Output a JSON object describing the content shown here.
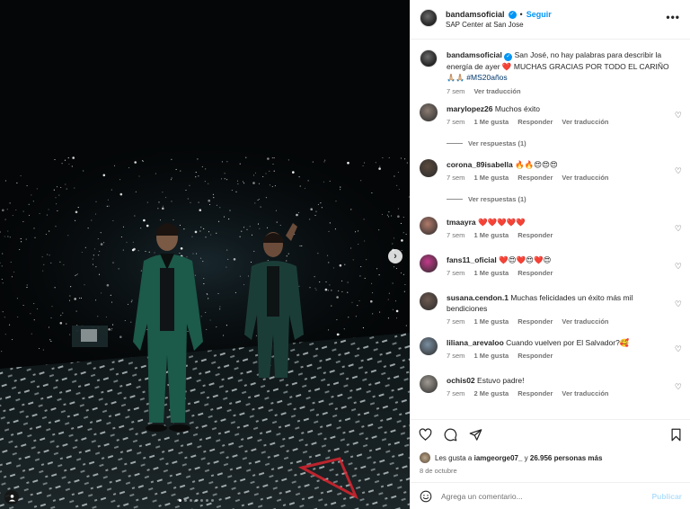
{
  "post": {
    "username": "bandamsoficial",
    "separator": "•",
    "follow_label": "Seguir",
    "location": "SAP Center at San Jose",
    "more_icon": "more-horizontal-icon"
  },
  "caption": {
    "username": "bandamsoficial",
    "text_before_heart": "San José, no hay palabras para describir la energía de ayer",
    "heart": "❤️",
    "text_after_heart": "MUCHAS GRACIAS POR TODO EL CARIÑO",
    "emojis": "🙏🏼🙏🏼",
    "hashtag": "#MS20años",
    "time": "7 sem",
    "translation": "Ver traducción"
  },
  "comments": [
    {
      "username": "marylopez26",
      "text": "Muchos éxito",
      "time": "7 sem",
      "likes": "1 Me gusta",
      "reply": "Responder",
      "translation": "Ver traducción",
      "replies": "Ver respuestas (1)",
      "avatar_color": "#8a7c72"
    },
    {
      "username": "corona_89isabella",
      "text": "🔥🔥😍😍😍",
      "time": "7 sem",
      "likes": "1 Me gusta",
      "reply": "Responder",
      "translation": "Ver traducción",
      "replies": "Ver respuestas (1)",
      "avatar_color": "#5a4a3e"
    },
    {
      "username": "tmaayra",
      "text": "❤️❤️❤️❤️❤️",
      "time": "7 sem",
      "likes": "1 Me gusta",
      "reply": "Responder",
      "translation": "",
      "replies": "",
      "avatar_color": "#b07a6a"
    },
    {
      "username": "fans11_oficial",
      "text": "❤️😍❤️😍❤️😍",
      "time": "7 sem",
      "likes": "1 Me gusta",
      "reply": "Responder",
      "translation": "",
      "replies": "",
      "avatar_color": "#c23a8a"
    },
    {
      "username": "susana.cendon.1",
      "text": "Muchas felicidades un éxito más mil bendiciones",
      "time": "7 sem",
      "likes": "1 Me gusta",
      "reply": "Responder",
      "translation": "Ver traducción",
      "replies": "",
      "avatar_color": "#6d5a50"
    },
    {
      "username": "liliana_arevaloo",
      "text": "Cuando vuelven por El Salvador?🥰",
      "time": "7 sem",
      "likes": "1 Me gusta",
      "reply": "Responder",
      "translation": "",
      "replies": "",
      "avatar_color": "#7a8ea0"
    },
    {
      "username": "ochis02",
      "text": "Estuvo padre!",
      "time": "7 sem",
      "likes": "2 Me gusta",
      "reply": "Responder",
      "translation": "Ver traducción",
      "replies": "",
      "avatar_color": "#a09a92"
    }
  ],
  "actions": {
    "like_icon": "heart-icon",
    "comment_icon": "comment-icon",
    "share_icon": "share-icon",
    "save_icon": "bookmark-icon",
    "likes_prefix": "Les gusta a",
    "likes_user": "iamgeorge07_",
    "likes_suffix": "y",
    "likes_count": "26.956 personas más",
    "date": "8 de octubre"
  },
  "add_comment": {
    "placeholder": "Agrega un comentario...",
    "post_label": "Publicar"
  },
  "media": {
    "carousel_total": 7,
    "carousel_active": 1
  }
}
